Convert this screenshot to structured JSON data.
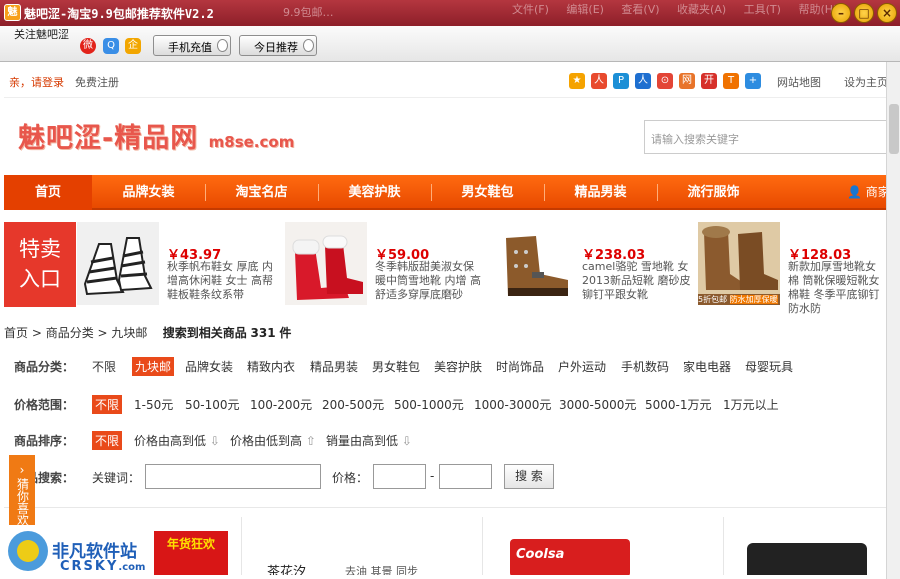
{
  "window": {
    "title": "魅吧涩-淘宝9.9包邮推荐软件V2.2",
    "app_icon": "app-logo-icon",
    "ghost_tab": "9.9包邮…",
    "ghost_menu": "文件(F) 编辑(E) 查看(V) 收藏夹(A) 工具(T) 帮助(H)"
  },
  "toolbar": {
    "follow_label": "关注魅吧涩",
    "social_icons": [
      "weibo-icon",
      "qzone-icon",
      "qq-icon"
    ],
    "recharge_button": "手机充值",
    "today_button": "今日推荐"
  },
  "topbar": {
    "login": "亲，请登录",
    "register": "免费注册",
    "share_icons": [
      "star-icon",
      "renren-icon",
      "douban-icon",
      "people-icon",
      "msn-icon",
      "tqq-icon",
      "kaixin-icon",
      "t-icon",
      "plus-icon"
    ],
    "sitemap": "网站地图",
    "sethome": "设为主页"
  },
  "header": {
    "logo_text": "魅吧涩-精品网",
    "logo_domain": "m8se.com",
    "search_placeholder": "请输入搜索关键字"
  },
  "nav": {
    "items": [
      "首页",
      "品牌女装",
      "淘宝名店",
      "美容护肤",
      "男女鞋包",
      "精品男装",
      "流行服饰"
    ],
    "user_label": "商家"
  },
  "promo": {
    "badge_line1": "特卖",
    "badge_line2": "入口",
    "products": [
      {
        "price": "￥43.97",
        "desc": "秋季帆布鞋女 厚底 内增高休闲鞋 女士 高帮鞋板鞋条纹系带"
      },
      {
        "price": "￥59.00",
        "desc": "冬季韩版甜美淑女保 暖中筒雪地靴 内增 高舒适多穿厚底磨砂"
      },
      {
        "price": "￥238.03",
        "desc": "camel骆驼 雪地靴 女 2013新品短靴 磨砂皮铆钉平跟女靴"
      },
      {
        "price": "￥128.03",
        "desc": "新款加厚雪地靴女棉 筒靴保暖短靴女棉鞋 冬季平底铆钉防水防"
      }
    ],
    "promo_tags": [
      "5折包邮",
      "防水加厚保暖"
    ]
  },
  "breadcrumb": {
    "home": "首页",
    "category": "商品分类",
    "current": "九块邮",
    "result_prefix": "搜索到相关商品",
    "count": "331",
    "unit": "件"
  },
  "filters": {
    "category_label": "商品分类：",
    "category_options": [
      "不限",
      "九块邮",
      "品牌女装",
      "精致内衣",
      "精品男装",
      "男女鞋包",
      "美容护肤",
      "时尚饰品",
      "户外运动",
      "手机数码",
      "家电电器",
      "母婴玩具"
    ],
    "category_selected": "九块邮",
    "price_label": "价格范围：",
    "price_options": [
      "不限",
      "1-50元",
      "50-100元",
      "100-200元",
      "200-500元",
      "500-1000元",
      "1000-3000元",
      "3000-5000元",
      "5000-1万元",
      "1万元以上"
    ],
    "price_selected": "不限",
    "sort_label": "商品排序：",
    "sort_options": [
      "不限",
      "价格由高到低",
      "价格由低到高",
      "销量由高到低"
    ],
    "sort_selected": "不限",
    "search_label": "商品搜索：",
    "keyword_label": "关键词：",
    "price_field_label": "价格：",
    "price_dash": "-",
    "search_button": "搜 索"
  },
  "side_tab": "猜你喜欢",
  "bottom": {
    "banner_text": "年货狂欢",
    "tea_brand": "茶花汐",
    "tea_text": "去油 其景 同步",
    "coolsa": "Coolsa",
    "watermark_cn": "非凡软件站",
    "watermark_en": "CRSKY",
    "watermark_domain": ".com"
  },
  "colors": {
    "title_bar": "#a02a35",
    "nav_orange": "#f25c0a",
    "accent_red": "#e6382b",
    "price_red": "#dd0000"
  }
}
